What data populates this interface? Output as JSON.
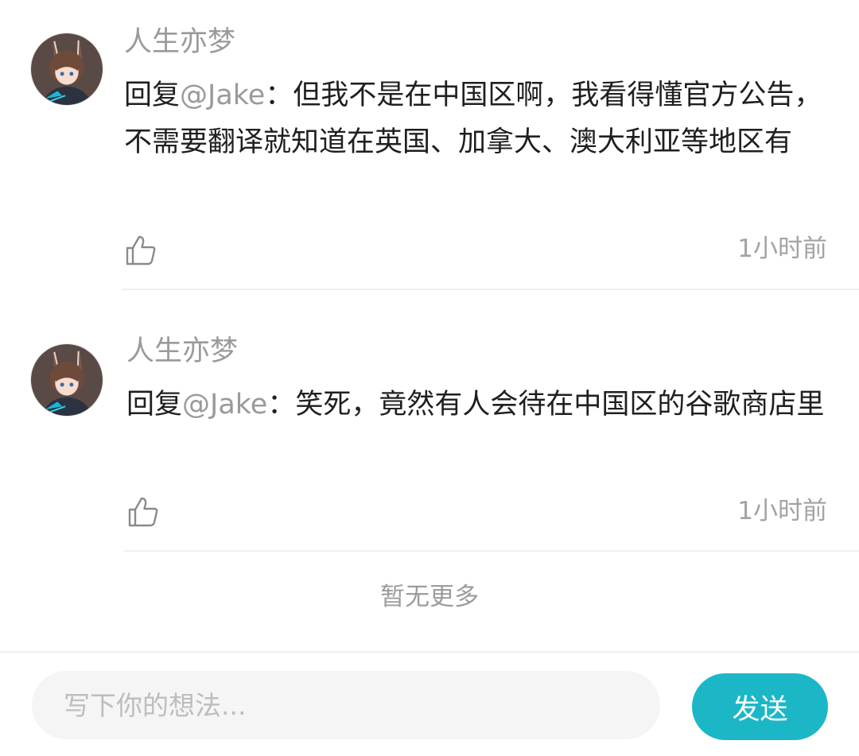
{
  "comments": [
    {
      "username": "人生亦梦",
      "reply_prefix": "回复",
      "mention": "@Jake",
      "separator": "：",
      "text": "但我不是在中国区啊，我看得懂官方公告，不需要翻译就知道在英国、加拿大、澳大利亚等地区有",
      "time": "1小时前",
      "like_icon": "thumbs-up-icon"
    },
    {
      "username": "人生亦梦",
      "reply_prefix": "回复",
      "mention": "@Jake",
      "separator": "：",
      "text": "笑死，竟然有人会待在中国区的谷歌商店里",
      "time": "1小时前",
      "like_icon": "thumbs-up-icon"
    }
  ],
  "footer": {
    "no_more": "暂无更多"
  },
  "composer": {
    "placeholder": "写下你的想法...",
    "send_label": "发送",
    "send_color": "#1cb7c7"
  }
}
